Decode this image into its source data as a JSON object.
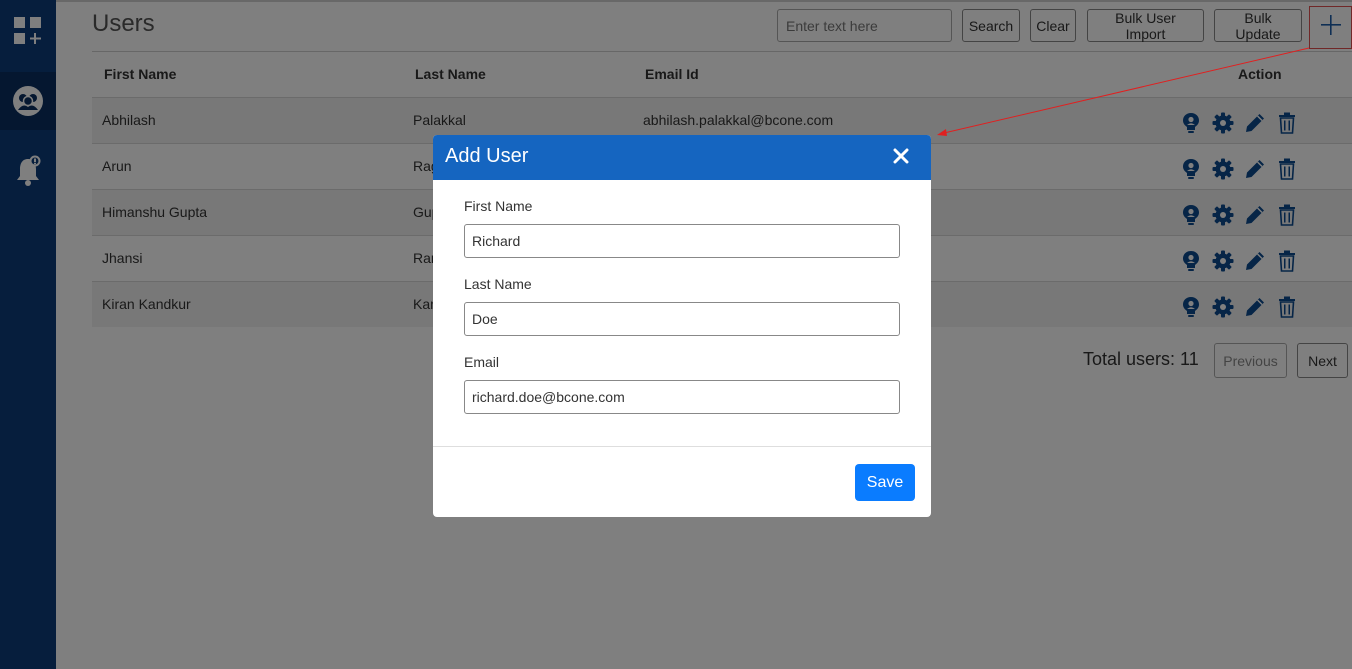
{
  "page": {
    "title": "Users"
  },
  "toolbar": {
    "search_placeholder": "Enter text here",
    "search_label": "Search",
    "clear_label": "Clear",
    "bulk_import_label": "Bulk User Import",
    "bulk_update_label": "Bulk Update",
    "add_icon": "plus-icon"
  },
  "sidebar": {
    "items": [
      {
        "icon": "dashboard-add-icon"
      },
      {
        "icon": "users-icon",
        "active": true
      },
      {
        "icon": "alert-bell-icon"
      }
    ]
  },
  "table": {
    "columns": [
      "First Name",
      "Last Name",
      "Email Id",
      "Action"
    ],
    "rows": [
      {
        "first": "Abhilash",
        "last": "Palakkal",
        "email": "abhilash.palakkal@bcone.com"
      },
      {
        "first": "Arun",
        "last": "Rag",
        "email": ""
      },
      {
        "first": "Himanshu Gupta",
        "last": "Gup",
        "email": ""
      },
      {
        "first": "Jhansi",
        "last": "Ran",
        "email": ""
      },
      {
        "first": "Kiran Kandkur",
        "last": "Kan",
        "email": ""
      }
    ],
    "action_icons": [
      "user-idea-icon",
      "settings-gear-icon",
      "edit-pencil-icon",
      "delete-trash-icon"
    ]
  },
  "pagination": {
    "total_text": "Total users: 11",
    "previous_label": "Previous",
    "next_label": "Next"
  },
  "modal": {
    "title": "Add User",
    "first_name_label": "First Name",
    "first_name_value": "Richard",
    "last_name_label": "Last Name",
    "last_name_value": "Doe",
    "email_label": "Email",
    "email_value": "richard.doe@bcone.com",
    "save_label": "Save"
  },
  "colors": {
    "sidebar": "#0d3c7a",
    "modal_header": "#1565c0",
    "primary_button": "#0a7cff",
    "action_icon": "#0d4a8f",
    "annotation": "#e05050"
  }
}
